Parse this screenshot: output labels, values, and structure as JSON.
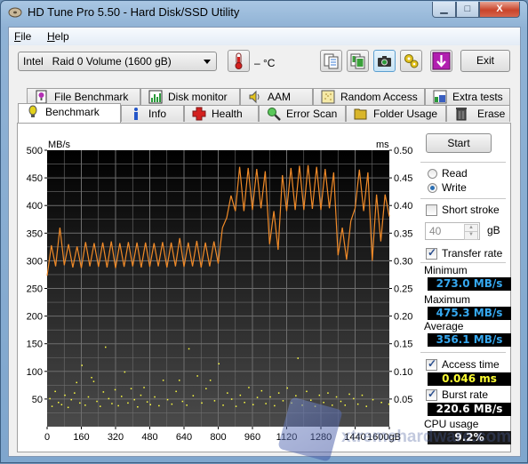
{
  "window": {
    "title": "HD Tune Pro 5.50 - Hard Disk/SSD Utility",
    "controls": {
      "minimize": "▁",
      "maximize": "□",
      "close": "X"
    }
  },
  "menu": {
    "file": "File",
    "help": "Help"
  },
  "toolbar": {
    "drive": "Intel   Raid 0 Volume (1600 gB)",
    "temperature": "– °C",
    "buttons": [
      "copy-text-icon",
      "copy-image-icon",
      "screenshot-icon",
      "options-icon",
      "save-icon"
    ],
    "exit_label": "Exit"
  },
  "tabs": {
    "row1": [
      {
        "label": "File Benchmark",
        "icon": "file-benchmark-icon"
      },
      {
        "label": "Disk monitor",
        "icon": "disk-monitor-icon"
      },
      {
        "label": "AAM",
        "icon": "speaker-icon"
      },
      {
        "label": "Random Access",
        "icon": "random-access-icon"
      },
      {
        "label": "Extra tests",
        "icon": "extra-tests-icon"
      }
    ],
    "row2": [
      {
        "label": "Benchmark",
        "icon": "bulb-icon",
        "selected": true
      },
      {
        "label": "Info",
        "icon": "info-icon"
      },
      {
        "label": "Health",
        "icon": "health-cross-icon"
      },
      {
        "label": "Error Scan",
        "icon": "magnifier-icon"
      },
      {
        "label": "Folder Usage",
        "icon": "folder-icon"
      },
      {
        "label": "Erase",
        "icon": "trash-icon"
      }
    ]
  },
  "controls": {
    "start_label": "Start",
    "mode_read": "Read",
    "mode_write": "Write",
    "selected_mode": "Write",
    "short_stroke_label": "Short stroke",
    "short_stroke_checked": false,
    "short_stroke_value": "40",
    "short_stroke_unit": "gB",
    "transfer_rate_label": "Transfer rate",
    "transfer_rate_checked": true,
    "minimum_label": "Minimum",
    "minimum_value": "273.0 MB/s",
    "maximum_label": "Maximum",
    "maximum_value": "475.3 MB/s",
    "average_label": "Average",
    "average_value": "356.1 MB/s",
    "access_time_label": "Access time",
    "access_time_checked": true,
    "access_time_value": "0.046 ms",
    "burst_rate_label": "Burst rate",
    "burst_rate_checked": true,
    "burst_rate_value": "220.6 MB/s",
    "cpu_usage_label": "CPU usage",
    "cpu_usage_value": "9.2%"
  },
  "watermark": {
    "text": "xtremehardware.com"
  },
  "chart_data": {
    "type": "line",
    "title": "",
    "xlabel": "gB",
    "ylabel": "MB/s",
    "y2label": "ms",
    "xlim": [
      0,
      1600
    ],
    "ylim": [
      0,
      500
    ],
    "y2lim": [
      0,
      0.5
    ],
    "x_ticks": [
      "0",
      "160",
      "320",
      "480",
      "640",
      "800",
      "960",
      "1120",
      "1280",
      "1440",
      "1600gB"
    ],
    "y_ticks": [
      "500",
      "450",
      "400",
      "350",
      "300",
      "250",
      "200",
      "150",
      "100",
      "50"
    ],
    "y2_ticks": [
      "0.50",
      "0.45",
      "0.40",
      "0.35",
      "0.30",
      "0.25",
      "0.20",
      "0.15",
      "0.10",
      "0.05"
    ],
    "grid": true,
    "colors": {
      "transfer": "#f08a28",
      "access": "#ffff40",
      "background_top": "#000000",
      "background_bottom": "#4a4a4a",
      "grid": "#6e6e6e"
    },
    "series": [
      {
        "name": "Transfer rate (MB/s)",
        "kind": "line",
        "x": [
          0,
          20,
          40,
          60,
          80,
          100,
          120,
          140,
          160,
          180,
          200,
          220,
          240,
          260,
          280,
          300,
          320,
          340,
          360,
          380,
          400,
          420,
          440,
          460,
          480,
          500,
          520,
          540,
          560,
          580,
          600,
          620,
          640,
          660,
          680,
          700,
          720,
          740,
          760,
          780,
          800,
          820,
          840,
          860,
          880,
          900,
          920,
          940,
          960,
          980,
          1000,
          1020,
          1040,
          1060,
          1080,
          1100,
          1120,
          1140,
          1160,
          1180,
          1200,
          1220,
          1240,
          1260,
          1280,
          1300,
          1320,
          1340,
          1360,
          1380,
          1400,
          1420,
          1440,
          1460,
          1480,
          1500,
          1520,
          1540,
          1560,
          1580,
          1600
        ],
        "values": [
          273,
          328,
          290,
          360,
          292,
          330,
          288,
          326,
          287,
          334,
          290,
          332,
          289,
          333,
          288,
          335,
          287,
          332,
          289,
          334,
          290,
          333,
          288,
          333,
          289,
          332,
          290,
          334,
          288,
          333,
          290,
          341,
          289,
          333,
          290,
          336,
          288,
          333,
          290,
          335,
          295,
          360,
          378,
          418,
          390,
          470,
          390,
          468,
          392,
          466,
          395,
          462,
          330,
          390,
          320,
          455,
          390,
          468,
          392,
          472,
          392,
          473,
          394,
          470,
          392,
          466,
          395,
          460,
          310,
          360,
          302,
          372,
          395,
          465,
          390,
          460,
          300,
          420,
          335,
          420,
          380
        ]
      },
      {
        "name": "Access time (ms)",
        "kind": "scatter",
        "summary": "Dense band of points mostly between 0.030 and 0.070 ms across the full 0–1600 gB range, with sparse outliers up to ~0.145 ms",
        "points": [
          [
            10,
            0.052
          ],
          [
            20,
            0.038
          ],
          [
            35,
            0.065
          ],
          [
            50,
            0.045
          ],
          [
            65,
            0.041
          ],
          [
            80,
            0.058
          ],
          [
            95,
            0.036
          ],
          [
            110,
            0.05
          ],
          [
            125,
            0.062
          ],
          [
            135,
            0.081
          ],
          [
            150,
            0.044
          ],
          [
            160,
            0.112
          ],
          [
            175,
            0.04
          ],
          [
            190,
            0.055
          ],
          [
            205,
            0.09
          ],
          [
            215,
            0.083
          ],
          [
            230,
            0.047
          ],
          [
            245,
            0.038
          ],
          [
            260,
            0.064
          ],
          [
            270,
            0.145
          ],
          [
            285,
            0.052
          ],
          [
            300,
            0.043
          ],
          [
            315,
            0.068
          ],
          [
            330,
            0.039
          ],
          [
            345,
            0.056
          ],
          [
            360,
            0.1
          ],
          [
            375,
            0.044
          ],
          [
            390,
            0.07
          ],
          [
            405,
            0.05
          ],
          [
            420,
            0.037
          ],
          [
            435,
            0.058
          ],
          [
            450,
            0.072
          ],
          [
            465,
            0.046
          ],
          [
            480,
            0.041
          ],
          [
            500,
            0.055
          ],
          [
            520,
            0.039
          ],
          [
            540,
            0.085
          ],
          [
            560,
            0.05
          ],
          [
            580,
            0.042
          ],
          [
            600,
            0.065
          ],
          [
            615,
            0.085
          ],
          [
            630,
            0.047
          ],
          [
            650,
            0.04
          ],
          [
            660,
            0.142
          ],
          [
            680,
            0.057
          ],
          [
            700,
            0.093
          ],
          [
            720,
            0.044
          ],
          [
            740,
            0.07
          ],
          [
            760,
            0.085
          ],
          [
            780,
            0.048
          ],
          [
            800,
            0.115
          ],
          [
            820,
            0.04
          ],
          [
            840,
            0.062
          ],
          [
            860,
            0.051
          ],
          [
            880,
            0.038
          ],
          [
            900,
            0.058
          ],
          [
            920,
            0.045
          ],
          [
            940,
            0.072
          ],
          [
            960,
            0.041
          ],
          [
            980,
            0.054
          ],
          [
            1000,
            0.066
          ],
          [
            1020,
            0.043
          ],
          [
            1040,
            0.055
          ],
          [
            1060,
            0.039
          ],
          [
            1080,
            0.062
          ],
          [
            1100,
            0.048
          ],
          [
            1120,
            0.071
          ],
          [
            1140,
            0.044
          ],
          [
            1160,
            0.057
          ],
          [
            1170,
            0.125
          ],
          [
            1190,
            0.04
          ],
          [
            1210,
            0.065
          ],
          [
            1230,
            0.049
          ],
          [
            1250,
            0.038
          ],
          [
            1270,
            0.058
          ],
          [
            1290,
            0.045
          ],
          [
            1310,
            0.062
          ],
          [
            1330,
            0.04
          ],
          [
            1350,
            0.055
          ],
          [
            1370,
            0.047
          ],
          [
            1390,
            0.04
          ],
          [
            1410,
            0.06
          ],
          [
            1430,
            0.052
          ],
          [
            1450,
            0.042
          ],
          [
            1470,
            0.058
          ],
          [
            1490,
            0.038
          ],
          [
            1520,
            0.05
          ],
          [
            1560,
            0.045
          ],
          [
            1595,
            0.042
          ]
        ]
      }
    ]
  }
}
